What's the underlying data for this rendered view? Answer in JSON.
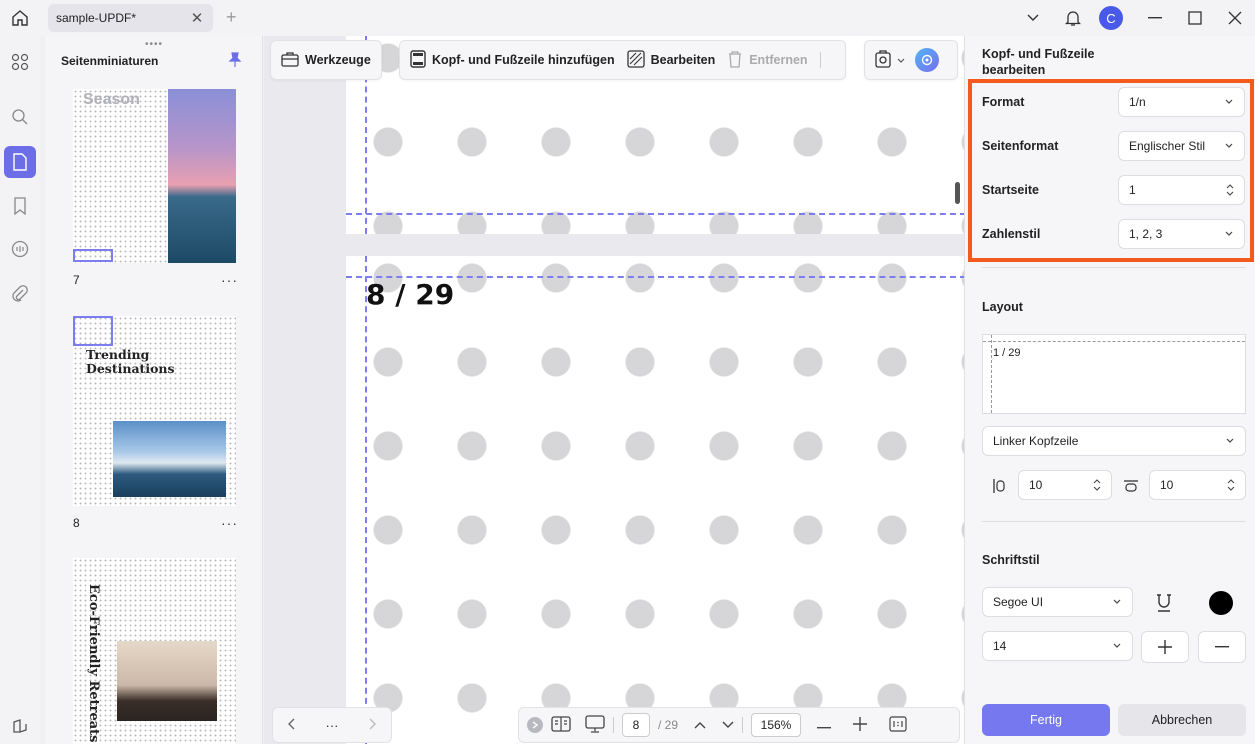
{
  "titlebar": {
    "tab_title": "sample-UPDF*",
    "avatar_letter": "C"
  },
  "thumbnails": {
    "header": "Seitenminiaturen",
    "items": [
      {
        "label": "7",
        "title": "Season"
      },
      {
        "label": "8",
        "title": "Trending Destinations"
      },
      {
        "label": "",
        "title": "Eco-Friendly Retreats"
      }
    ]
  },
  "toolbar": {
    "tools_label": "Werkzeuge",
    "add_header_footer_label": "Kopf- und Fußzeile hinzufügen",
    "edit_label": "Bearbeiten",
    "remove_label": "Entfernen"
  },
  "document": {
    "page_number_text": "8 / 29"
  },
  "bottom": {
    "current_page": "8",
    "total_pages": "/ 29",
    "zoom": "156%",
    "more": "···"
  },
  "panel": {
    "title": "Kopf- und Fußzeile bearbeiten",
    "format_label": "Format",
    "format_value": "1/n",
    "page_format_label": "Seitenformat",
    "page_format_value": "Englischer Stil",
    "start_page_label": "Startseite",
    "start_page_value": "1",
    "number_style_label": "Zahlenstil",
    "number_style_value": "1, 2, 3",
    "layout_label": "Layout",
    "layout_preview_text": "1 / 29",
    "position_value": "Linker Kopfzeile",
    "margin_left_value": "10",
    "margin_top_value": "10",
    "font_style_label": "Schriftstil",
    "font_value": "Segoe UI",
    "font_size_value": "14",
    "text_color": "#000000",
    "done_label": "Fertig",
    "cancel_label": "Abbrechen"
  },
  "colors": {
    "accent": "#7678f0",
    "highlight": "#f25a1e",
    "dash": "#7c7ef0"
  }
}
